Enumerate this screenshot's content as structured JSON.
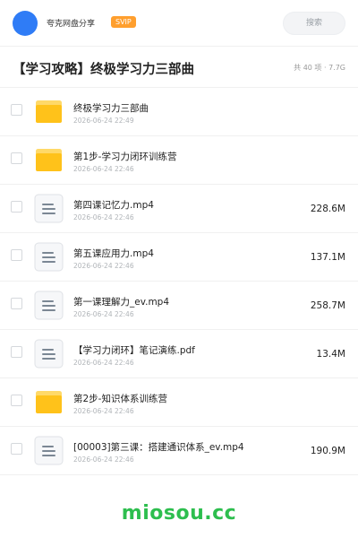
{
  "header": {
    "username": "夸克网盘分享",
    "vip_badge": "SVIP",
    "search_placeholder": "搜索",
    "avatar_color": "#2f7cf6"
  },
  "folder": {
    "title": "【学习攻略】终极学习力三部曲",
    "summary": "共 40 项 · 7.7G"
  },
  "items": [
    {
      "type": "folder",
      "name": "终极学习力三部曲",
      "date": "2026-06-24 22:49",
      "size": ""
    },
    {
      "type": "folder",
      "name": "第1步-学习力闭环训练营",
      "date": "2026-06-24 22:46",
      "size": ""
    },
    {
      "type": "file",
      "name": "第四课记忆力.mp4",
      "date": "2026-06-24 22:46",
      "size": "228.6M"
    },
    {
      "type": "file",
      "name": "第五课应用力.mp4",
      "date": "2026-06-24 22:46",
      "size": "137.1M"
    },
    {
      "type": "file",
      "name": "第一课理解力_ev.mp4",
      "date": "2026-06-24 22:46",
      "size": "258.7M"
    },
    {
      "type": "file",
      "name": "【学习力闭环】笔记演练.pdf",
      "date": "2026-06-24 22:46",
      "size": "13.4M"
    },
    {
      "type": "folder",
      "name": "第2步-知识体系训练营",
      "date": "2026-06-24 22:46",
      "size": ""
    },
    {
      "type": "file",
      "name": "[00003]第三课：搭建通识体系_ev.mp4",
      "date": "2026-06-24 22:46",
      "size": "190.9M"
    }
  ],
  "watermark": "miosou.cc",
  "colors": {
    "folder_yellow": "#ffc21a",
    "folder_tab": "#ffd968",
    "vip_orange": "#ff9f2e",
    "watermark_green": "#2dbe4e"
  }
}
